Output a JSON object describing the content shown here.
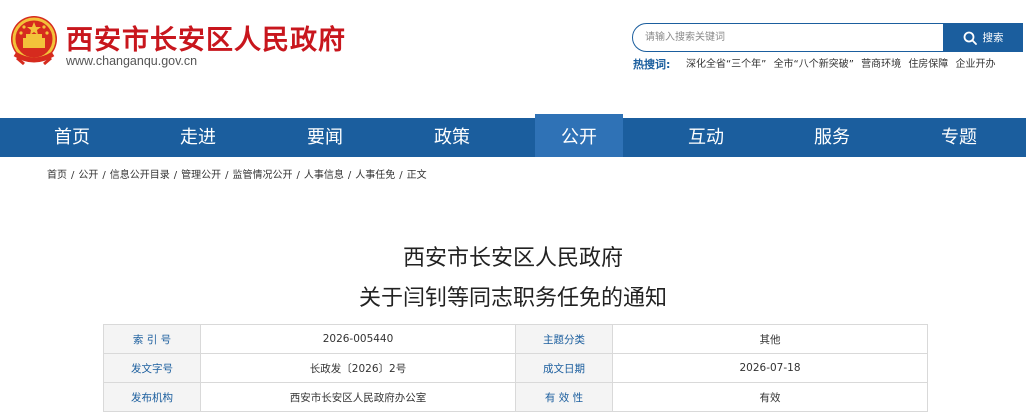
{
  "header": {
    "site_name": "西安市长安区人民政府",
    "site_url": "www.changanqu.gov.cn",
    "emblem_icon": "national-emblem-icon"
  },
  "search": {
    "placeholder": "请输入搜索关键词",
    "button_label": "搜索",
    "button_icon": "search-icon"
  },
  "hot": {
    "label": "热搜词:",
    "items": [
      "深化全省“三个年”",
      "全市“八个新突破”",
      "营商环境",
      "住房保障",
      "企业开办"
    ]
  },
  "nav": {
    "items": [
      {
        "label": "首页"
      },
      {
        "label": "走进"
      },
      {
        "label": "要闻"
      },
      {
        "label": "政策"
      },
      {
        "label": "公开"
      },
      {
        "label": "互动"
      },
      {
        "label": "服务"
      },
      {
        "label": "专题"
      }
    ],
    "active_index": 4
  },
  "breadcrumb": [
    "首页",
    "公开",
    "信息公开目录",
    "管理公开",
    "监管情况公开",
    "人事信息",
    "人事任免",
    "正文"
  ],
  "article": {
    "title_line1": "西安市长安区人民政府",
    "title_line2": "关于闫钊等同志职务任免的通知"
  },
  "info": {
    "rows": [
      {
        "k1": "索 引 号",
        "v1": "2026-005440",
        "k2": "主题分类",
        "v2": "其他"
      },
      {
        "k1": "发文字号",
        "v1": "长政发〔2026〕2号",
        "k2": "成文日期",
        "v2": "2026-07-18"
      },
      {
        "k1": "发布机构",
        "v1": "西安市长安区人民政府办公室",
        "k2": "有 效 性",
        "v2": "有效"
      }
    ]
  },
  "colors": {
    "brand_red": "#c8161d",
    "nav_blue": "#1b5e9e",
    "nav_active": "#2f72b6"
  }
}
